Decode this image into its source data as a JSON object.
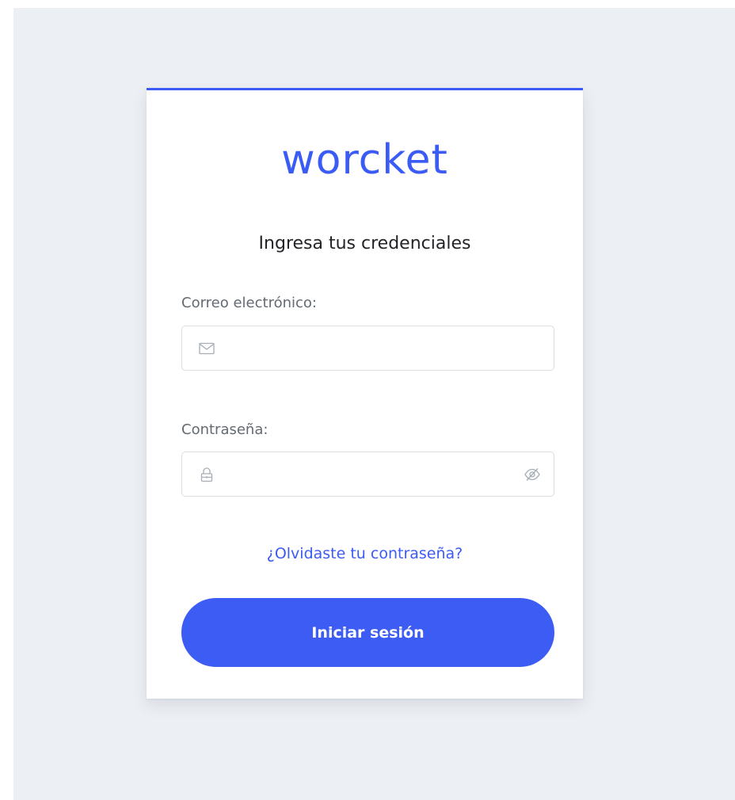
{
  "brand": {
    "logo_text": "worcket",
    "accent_color": "#3b5bf5"
  },
  "login": {
    "subtitle": "Ingresa tus credenciales",
    "email": {
      "label": "Correo electrónico:",
      "value": "",
      "placeholder": "",
      "icon": "envelope-icon"
    },
    "password": {
      "label": "Contraseña:",
      "value": "",
      "placeholder": "",
      "icon": "lock-icon",
      "toggle_icon": "eye-slash-icon"
    },
    "forgot_link": "¿Olvidaste tu contraseña?",
    "submit_label": "Iniciar sesión"
  }
}
